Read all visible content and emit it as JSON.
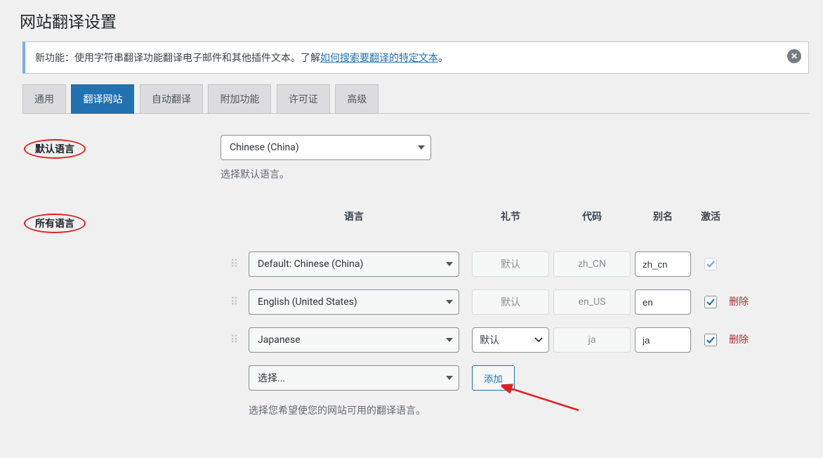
{
  "page_title": "网站翻译设置",
  "notice": {
    "text_before": "新功能：使用字符串翻译功能翻译电子邮件和其他插件文本。了解",
    "link_text": "如何搜索要翻译的特定文本",
    "text_after": "。"
  },
  "tabs": [
    "通用",
    "翻译网站",
    "自动翻译",
    "附加功能",
    "许可证",
    "高级"
  ],
  "active_tab_index": 1,
  "default_language": {
    "label": "默认语言",
    "value": "Chinese (China)",
    "description": "选择默认语言。"
  },
  "all_languages": {
    "label": "所有语言",
    "headers": {
      "language": "语言",
      "formality": "礼节",
      "code": "代码",
      "alias": "别名",
      "active": "激活"
    },
    "rows": [
      {
        "language": "Default: Chinese (China)",
        "formality_placeholder": "默认",
        "formality_type": "readonly",
        "code": "zh_CN",
        "alias": "zh_cn",
        "active": true,
        "active_disabled": true,
        "deletable": false
      },
      {
        "language": "English (United States)",
        "formality_placeholder": "默认",
        "formality_type": "readonly",
        "code": "en_US",
        "alias": "en",
        "active": true,
        "active_disabled": false,
        "deletable": true
      },
      {
        "language": "Japanese",
        "formality_placeholder": "默认",
        "formality_type": "select",
        "code": "ja",
        "alias": "ja",
        "active": true,
        "active_disabled": false,
        "deletable": true
      }
    ],
    "add_row": {
      "placeholder": "选择...",
      "button": "添加"
    },
    "description": "选择您希望使您的网站可用的翻译语言。",
    "delete_label": "删除"
  }
}
